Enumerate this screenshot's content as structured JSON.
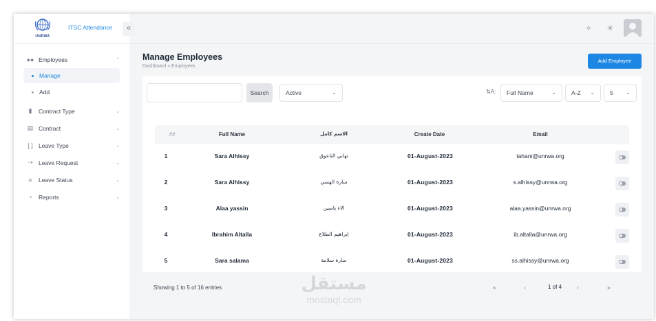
{
  "app": {
    "title": "ITSC Attendance",
    "logo_text": "UNRWA"
  },
  "sidebar": {
    "collapse_icon": "double-chevron-left-icon",
    "items": [
      {
        "label": "Employees",
        "icon": "users-icon",
        "expanded": true,
        "children": [
          {
            "label": "Manage",
            "active": true
          },
          {
            "label": "Add",
            "active": false
          }
        ]
      },
      {
        "label": "Contract Type",
        "icon": "building-icon"
      },
      {
        "label": "Contract",
        "icon": "document-icon"
      },
      {
        "label": "Leave Type",
        "icon": "bracket-icon"
      },
      {
        "label": "Leave Request",
        "icon": "walking-person-icon"
      },
      {
        "label": "Leave Status",
        "icon": "list-icon"
      },
      {
        "label": "Reports",
        "icon": "pie-chart-icon"
      }
    ]
  },
  "header": {
    "icons": [
      "sparkle-icon",
      "sun-icon",
      "avatar"
    ]
  },
  "page": {
    "title": "Manage Employees",
    "breadcrumb": "Dashboard  »  Employees",
    "add_button": "Add Employee"
  },
  "filters": {
    "search_value": "",
    "search_button": "Search",
    "status": "Active",
    "sort_field": "Full Name",
    "sort_order": "A-Z",
    "page_size": "5"
  },
  "table": {
    "headers": [
      "##",
      "Full Name",
      "الاسم كامل",
      "Create Date",
      "Email"
    ],
    "rows": [
      {
        "index": "1",
        "name": "Sara Alhissy",
        "name_ar": "تهاني الناعوق",
        "date": "01-August-2023",
        "email": "tahani@unrwa.org"
      },
      {
        "index": "2",
        "name": "Sara Alhissy",
        "name_ar": "سارة الهسي",
        "date": "01-August-2023",
        "email": "s.alhissy@unrwa.org"
      },
      {
        "index": "3",
        "name": "Alaa yassin",
        "name_ar": "الاء ياسين",
        "date": "01-August-2023",
        "email": "alaa.yassin@unrwa.org"
      },
      {
        "index": "4",
        "name": "Ibrahim Altalla",
        "name_ar": "إبراهيم الطلاع",
        "date": "01-August-2023",
        "email": "ib.altalla@unrwa.org"
      },
      {
        "index": "5",
        "name": "Sara salama",
        "name_ar": "سارة سلامة",
        "date": "01-August-2023",
        "email": "ss.alhissy@unrwa.org"
      }
    ]
  },
  "footer": {
    "showing": "Showing 1  to  5  of   16 entries",
    "first": "«",
    "prev": "‹",
    "page_info": "1 of 4",
    "next": "›",
    "last": "»"
  },
  "watermark": {
    "arabic": "مستقل",
    "latin": "mostaql.com"
  },
  "colors": {
    "accent": "#1d87e4",
    "background": "#f4f5f7"
  }
}
